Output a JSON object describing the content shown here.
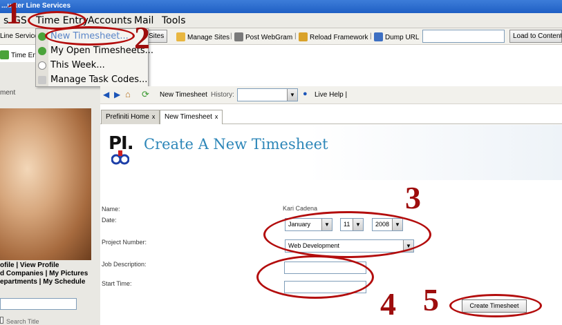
{
  "window": {
    "title": "...uster Line Services"
  },
  "menubar": {
    "items": [
      "s",
      "GS",
      "Time Entry",
      "Accounts",
      "Mail",
      "Tools"
    ]
  },
  "toolbar": {
    "services_label": "Line Services",
    "sites_btn": "Sites",
    "manage_sites": "Manage Sites",
    "post_webgram": "Post WebGram",
    "reload_framework": "Reload Framework",
    "dump_url": "Dump URL",
    "url_value": "",
    "load_btn": "Load to Content"
  },
  "row2": {
    "time_entry": "Time En"
  },
  "dropdown": {
    "items": [
      "New Timesheet...",
      "My Open Timesheets...",
      "This Week...",
      "Manage Task Codes..."
    ]
  },
  "left": {
    "panel_title": "ment",
    "links": [
      "ofile | View Profile",
      "d Companies | My Pictures",
      "epartments | My Schedule"
    ],
    "search_value": "",
    "search_title": "Search Title"
  },
  "navbar": {
    "page": "New Timesheet",
    "history_label": "History:",
    "history_value": "",
    "live_help": "Live Help |"
  },
  "tabs": [
    {
      "label": "Prefiniti Home",
      "close": "x"
    },
    {
      "label": "New Timesheet",
      "close": "x"
    }
  ],
  "header": {
    "logo_text": "PI.",
    "title": "Create A New Timesheet"
  },
  "form": {
    "name_label": "Name:",
    "name_value": "Kari Cadena",
    "date_label": "Date:",
    "month": "January",
    "day": "11",
    "year": "2008",
    "project_label": "Project Number:",
    "project_value": "Web Development",
    "job_label": "Job Description:",
    "job_value": "",
    "start_label": "Start Time:",
    "start_value": "",
    "submit": "Create Timesheet"
  },
  "annotations": [
    "1",
    "2",
    "3",
    "4",
    "5"
  ],
  "colors": {
    "annotation": "#b30d0d",
    "title_blue": "#2c86b8",
    "link_blue": "#1c55b8"
  }
}
